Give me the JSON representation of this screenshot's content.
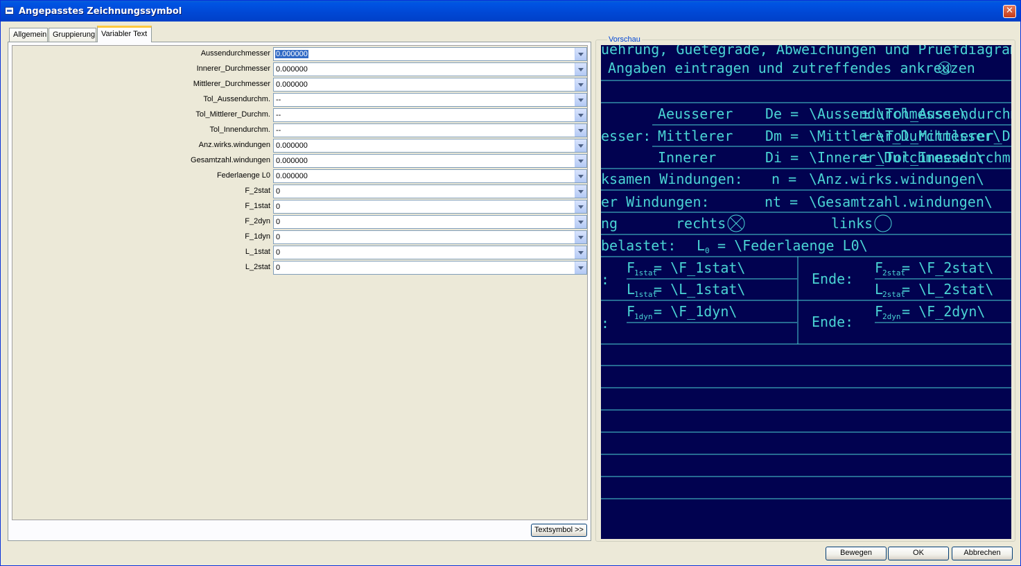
{
  "window": {
    "title": "Angepasstes Zeichnungssymbol",
    "close_glyph": "✕"
  },
  "tabs": [
    {
      "label": "Allgemein"
    },
    {
      "label": "Gruppierung"
    },
    {
      "label": "Variabler Text",
      "active": true
    }
  ],
  "fields": [
    {
      "label": "Aussendurchmesser",
      "value": "0.000000",
      "selected": true
    },
    {
      "label": "Innerer_Durchmesser",
      "value": "0.000000"
    },
    {
      "label": "Mittlerer_Durchmesser",
      "value": "0.000000"
    },
    {
      "label": "Tol_Aussendurchm.",
      "value": "--"
    },
    {
      "label": "Tol_Mittlerer_Durchm.",
      "value": "--"
    },
    {
      "label": "Tol_Innendurchm.",
      "value": "--"
    },
    {
      "label": "Anz.wirks.windungen",
      "value": "0.000000"
    },
    {
      "label": "Gesamtzahl.windungen",
      "value": "0.000000"
    },
    {
      "label": "Federlaenge L0",
      "value": "0.000000"
    },
    {
      "label": "F_2stat",
      "value": "0"
    },
    {
      "label": "F_1stat",
      "value": "0"
    },
    {
      "label": "F_2dyn",
      "value": "0"
    },
    {
      "label": "F_1dyn",
      "value": "0"
    },
    {
      "label": "L_1stat",
      "value": "0"
    },
    {
      "label": "L_2stat",
      "value": "0"
    }
  ],
  "textsymbol_button": "Textsymbol >>",
  "preview": {
    "legend": "Vorschau",
    "line1": "uehrung, Guetegrade, Abweichungen und Pruefdiagramm nach",
    "line2": "Angaben eintragen und zutreffendes ankreuzen",
    "aeusserer": "Aeusserer",
    "de": "De =",
    "aussen_var": "\\Aussendurchmesser\\",
    "tol_aussen": "\\Tol_Aussendurchm.",
    "esser": "esser:",
    "mittlerer": "Mittlerer",
    "dm": "Dm =",
    "mittler_var": "\\Mittlerer_Durchmesser\\",
    "tol_mittler": "\\Tol_Mittlerer_Dur",
    "innerer": "Innerer",
    "di": "Di =",
    "innerer_var": "\\Innerer_Durchmesser\\",
    "tol_innen": "\\Tol_Innendurchm.\\",
    "windungen_label": "ksamen Windungen:",
    "n": "n =",
    "anz_var": "\\Anz.wirks.windungen\\",
    "ges_label": "er Windungen:",
    "nt": "nt =",
    "ges_var": "\\Gesamtzahl.windungen\\",
    "ng": "ng",
    "rechts": "rechts",
    "links": "links",
    "belastet": "belastet:",
    "l0": "L",
    "l0_sub": "0",
    "l0_var": "= \\Federlaenge L0\\",
    "f1stat": "F",
    "f1stat_sub": "1stat",
    "f1stat_var": "=  \\F_1stat\\",
    "l1stat": "L",
    "l1stat_sub": "1stat",
    "l1stat_var": "= \\L_1stat\\",
    "ende1": "Ende:",
    "f2stat": "F",
    "f2stat_sub": "2stat",
    "f2stat_var": "=  \\F_2stat\\",
    "l2stat": "L",
    "l2stat_sub": "2stat",
    "l2stat_var": "=  \\L_2stat\\",
    "f1dyn": "F",
    "f1dyn_sub": "1dyn",
    "f1dyn_var": "=  \\F_1dyn\\",
    "ende2": "Ende:",
    "f2dyn": "F",
    "f2dyn_sub": "2dyn",
    "f2dyn_var": "=  \\F_2dyn\\",
    "colon": ":",
    "pm": "±",
    "colors": {
      "background": "#010250",
      "lines": "#4ad4d4"
    }
  },
  "buttons": {
    "move": "Bewegen",
    "ok": "OK",
    "cancel": "Abbrechen"
  }
}
